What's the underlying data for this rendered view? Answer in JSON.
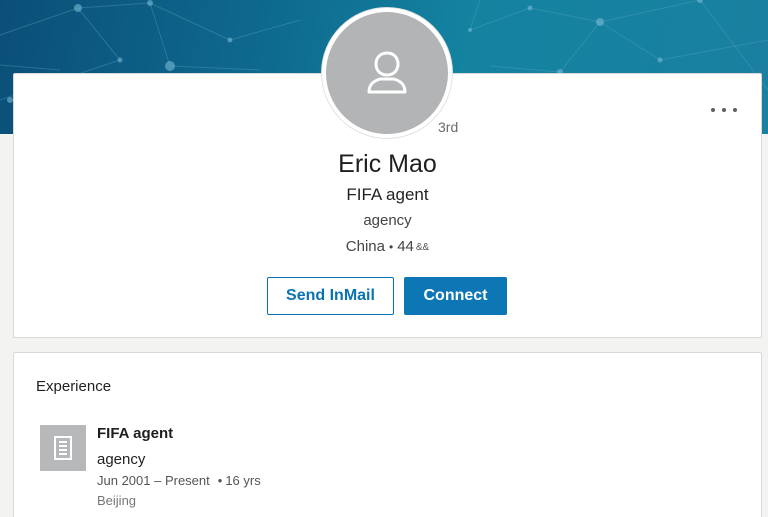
{
  "profile": {
    "name": "Eric Mao",
    "degree": "3rd",
    "headline": "FIFA agent",
    "company": "agency",
    "location": "China",
    "connections": "44",
    "icons": {
      "avatar": "person-placeholder-icon",
      "more": "more-options-icon",
      "connections": "connections-icon"
    }
  },
  "actions": {
    "send_inmail": "Send InMail",
    "connect": "Connect"
  },
  "experience": {
    "title": "Experience",
    "items": [
      {
        "role": "FIFA agent",
        "company": "agency",
        "dates": "Jun 2001 – Present",
        "duration": "16 yrs",
        "location": "Beijing",
        "logo_icon": "company-building-icon"
      }
    ]
  },
  "colors": {
    "accent": "#0a73b1",
    "banner": "#0e6a8f",
    "avatar_bg": "#b3b4b5"
  }
}
